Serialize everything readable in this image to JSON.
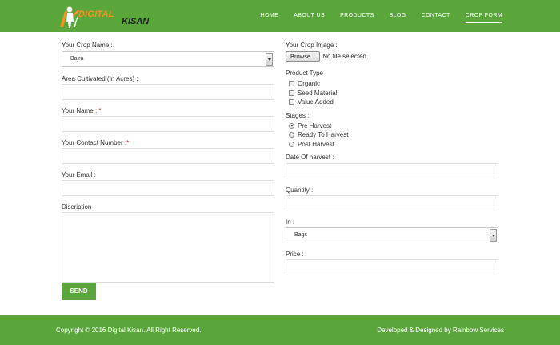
{
  "header": {
    "logo_part1": "DIGITAL",
    "logo_part2": "KISAN",
    "nav": [
      {
        "label": "HOME"
      },
      {
        "label": "ABOUT US"
      },
      {
        "label": "PRODUCTS"
      },
      {
        "label": "BLOG"
      },
      {
        "label": "CONTACT"
      },
      {
        "label": "CROP FORM"
      }
    ],
    "active_nav": "CROP FORM"
  },
  "form": {
    "crop_name_label": "Your Crop Name :",
    "crop_name_value": "Bajra",
    "area_label": "Area Cultivated (In Acres) :",
    "name_label": "Your Name :",
    "contact_label": "Your Contact Number :",
    "required_mark": "*",
    "email_label": "Your Email :",
    "description_label": "Discription",
    "send_label": "SEND",
    "crop_image_label": "Your Crop Image :",
    "browse_label": "Browse...",
    "file_status": "No file selected.",
    "product_type_label": "Product Type :",
    "product_types": [
      "Organic",
      "Seed Material",
      "Value Added"
    ],
    "stages_label": "Stages :",
    "stages": [
      "Pre Harvest",
      "Ready To Harvest",
      "Post Harvest"
    ],
    "selected_stage": "Pre Harvest",
    "harvest_date_label": "Date Of harvest :",
    "quantity_label": "Quantity :",
    "unit_label": "In :",
    "unit_value": "Bags",
    "price_label": "Price :"
  },
  "footer": {
    "copyright": "Copyright © 2016 Digital Kisan. All Right Reserved.",
    "credit": "Developed & Designed by Rainbow Services"
  },
  "colors": {
    "brand_green": "#5aa63a",
    "logo_orange": "#f7931e",
    "required_red": "#e01b1b"
  }
}
